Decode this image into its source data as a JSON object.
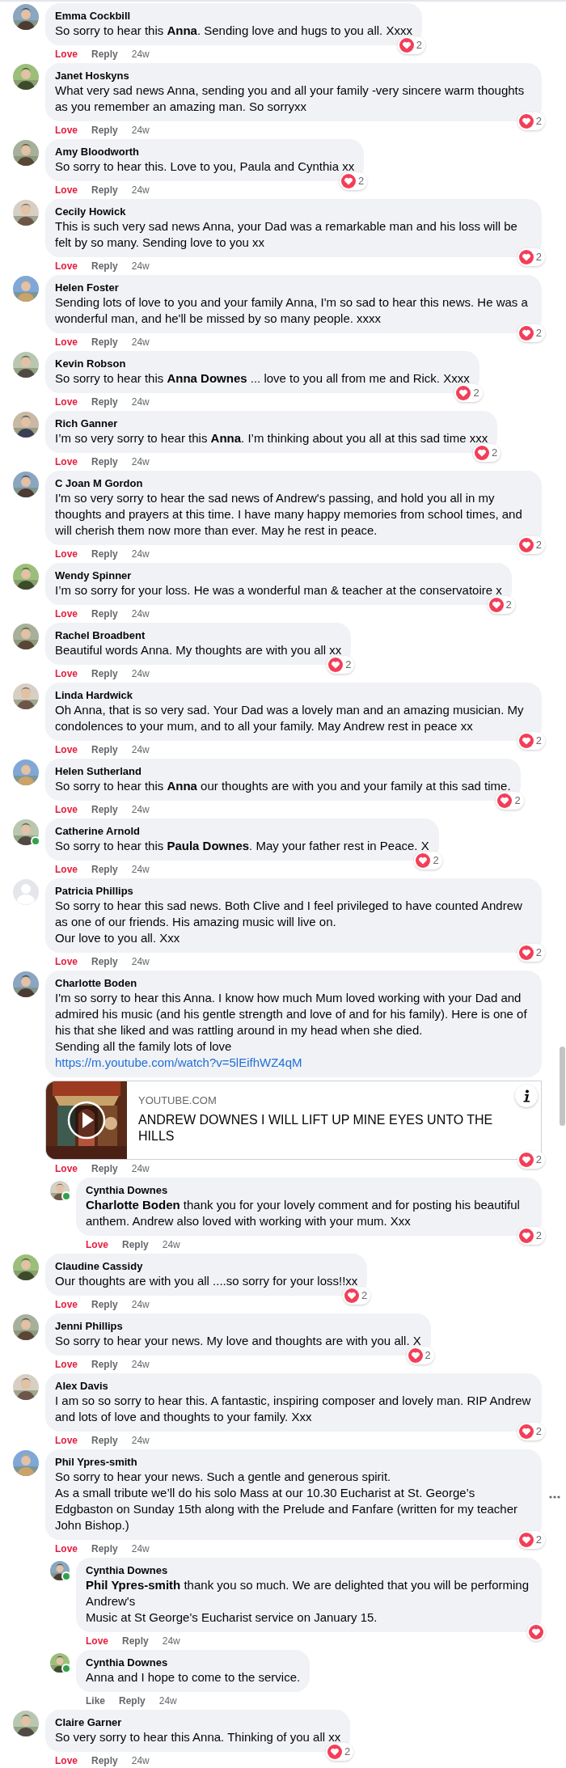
{
  "comments": [
    {
      "author": "Emma Cockbill",
      "default_avatar": false,
      "online": false,
      "text": "So sorry to hear this **Anna**. Sending love and hugs to you all. Xxxx",
      "react_label": "Love",
      "reacted": true,
      "reply_label": "Reply",
      "time": "24w",
      "reaction": {
        "kind": "love",
        "count": "2"
      }
    },
    {
      "author": "Janet Hoskyns",
      "default_avatar": false,
      "online": false,
      "text": "What very sad news Anna, sending you and all your family -very sincere warm thoughts as you remember an amazing man. So sorryxx",
      "react_label": "Love",
      "reacted": true,
      "reply_label": "Reply",
      "time": "24w",
      "reaction": {
        "kind": "love",
        "count": "2"
      }
    },
    {
      "author": "Amy Bloodworth",
      "default_avatar": false,
      "online": false,
      "text": "So sorry to hear this. Love to you, Paula and Cynthia xx",
      "react_label": "Love",
      "reacted": true,
      "reply_label": "Reply",
      "time": "24w",
      "reaction": {
        "kind": "love",
        "count": "2"
      }
    },
    {
      "author": "Cecily Howick",
      "default_avatar": false,
      "online": false,
      "text": "This is such very sad news Anna, your Dad was a remarkable man and his loss will be felt by so many. Sending love to you xx",
      "react_label": "Love",
      "reacted": true,
      "reply_label": "Reply",
      "time": "24w",
      "reaction": {
        "kind": "love",
        "count": "2"
      }
    },
    {
      "author": "Helen Foster",
      "default_avatar": false,
      "online": false,
      "text": "Sending lots of love to you and your family Anna, I'm so sad to hear this news. He was a wonderful man, and he'll be missed by so many people. xxxx",
      "react_label": "Love",
      "reacted": true,
      "reply_label": "Reply",
      "time": "24w",
      "reaction": {
        "kind": "love",
        "count": "2"
      }
    },
    {
      "author": "Kevin Robson",
      "default_avatar": false,
      "online": false,
      "text": "So sorry to hear this **Anna Downes** ... love to you all from me and Rick. Xxxx",
      "react_label": "Love",
      "reacted": true,
      "reply_label": "Reply",
      "time": "24w",
      "reaction": {
        "kind": "love",
        "count": "2"
      }
    },
    {
      "author": "Rich Ganner",
      "default_avatar": false,
      "online": false,
      "text": "I’m so very sorry to hear this **Anna**. I’m thinking about you all at this sad time xxx",
      "react_label": "Love",
      "reacted": true,
      "reply_label": "Reply",
      "time": "24w",
      "reaction": {
        "kind": "love",
        "count": "2"
      }
    },
    {
      "author": "C Joan M Gordon",
      "default_avatar": false,
      "online": false,
      "text": "I'm so very sorry to hear the sad news of Andrew's passing, and hold you all in my thoughts and prayers at this time. I have many happy memories from school times, and will cherish them now more than ever. May he rest in peace.",
      "react_label": "Love",
      "reacted": true,
      "reply_label": "Reply",
      "time": "24w",
      "reaction": {
        "kind": "love",
        "count": "2"
      }
    },
    {
      "author": "Wendy Spinner",
      "default_avatar": false,
      "online": false,
      "text": "I’m so sorry for your loss. He was a wonderful man & teacher at the conservatoire x",
      "react_label": "Love",
      "reacted": true,
      "reply_label": "Reply",
      "time": "24w",
      "reaction": {
        "kind": "love",
        "count": "2"
      }
    },
    {
      "author": "Rachel Broadbent",
      "default_avatar": false,
      "online": false,
      "text": "Beautiful words Anna. My thoughts are with you all xx",
      "react_label": "Love",
      "reacted": true,
      "reply_label": "Reply",
      "time": "24w",
      "reaction": {
        "kind": "love",
        "count": "2"
      }
    },
    {
      "author": "Linda Hardwick",
      "default_avatar": false,
      "online": false,
      "text": "Oh Anna, that is so very sad. Your Dad was a lovely man and an amazing musician. My condolences to your mum, and to all your family. May Andrew rest in peace xx",
      "react_label": "Love",
      "reacted": true,
      "reply_label": "Reply",
      "time": "24w",
      "reaction": {
        "kind": "love",
        "count": "2"
      }
    },
    {
      "author": "Helen Sutherland",
      "default_avatar": false,
      "online": false,
      "text": "So sorry to hear this **Anna** our thoughts are with you and your family at this sad time.",
      "react_label": "Love",
      "reacted": true,
      "reply_label": "Reply",
      "time": "24w",
      "reaction": {
        "kind": "love",
        "count": "2"
      }
    },
    {
      "author": "Catherine Arnold",
      "default_avatar": false,
      "online": true,
      "text": "So sorry to hear this **Paula Downes**. May your father rest in Peace. X",
      "react_label": "Love",
      "reacted": true,
      "reply_label": "Reply",
      "time": "24w",
      "reaction": {
        "kind": "love",
        "count": "2"
      }
    },
    {
      "author": "Patricia Phillips",
      "default_avatar": true,
      "online": false,
      "text": "So sorry to hear this sad news. Both Clive and I feel privileged to have counted Andrew as one of our friends. His amazing music will live on.\nOur love to you all. Xxx",
      "react_label": "Love",
      "reacted": true,
      "reply_label": "Reply",
      "time": "24w",
      "reaction": {
        "kind": "love",
        "count": "2"
      }
    },
    {
      "author": "Charlotte Boden",
      "default_avatar": false,
      "online": false,
      "text": "I'm so sorry to hear this Anna. I know how much Mum loved working with your Dad and admired his music (and his gentle strength and love of and for his family). Here is one of his that she liked and was rattling around in my head when she died.\nSending all the family lots of love",
      "link": "https://m.youtube.com/watch?v=5lEifhWZ4qM",
      "preview": {
        "domain": "YOUTUBE.COM",
        "title": "ANDREW DOWNES I WILL LIFT UP MINE EYES UNTO THE HILLS"
      },
      "react_label": "Love",
      "reacted": true,
      "reply_label": "Reply",
      "time": "24w",
      "reaction": {
        "kind": "love",
        "count": "2"
      },
      "replies": [
        {
          "author": "Cynthia Downes",
          "default_avatar": false,
          "online": true,
          "text": "**Charlotte Boden** thank you for your lovely comment and for posting his beautiful anthem. Andrew also loved with working with your mum. Xxx",
          "react_label": "Love",
          "reacted": true,
          "reply_label": "Reply",
          "time": "24w",
          "reaction": {
            "kind": "love",
            "count": "2"
          }
        }
      ]
    },
    {
      "author": "Claudine Cassidy",
      "default_avatar": false,
      "online": false,
      "text": "Our thoughts are with you all ....so sorry for your loss!!xx",
      "react_label": "Love",
      "reacted": true,
      "reply_label": "Reply",
      "time": "24w",
      "reaction": {
        "kind": "love",
        "count": "2"
      }
    },
    {
      "author": "Jenni Phillips",
      "default_avatar": false,
      "online": false,
      "text": "So sorry to hear your news. My love and thoughts are with you all. X",
      "react_label": "Love",
      "reacted": true,
      "reply_label": "Reply",
      "time": "24w",
      "reaction": {
        "kind": "love",
        "count": "2"
      }
    },
    {
      "author": "Alex Davis",
      "default_avatar": false,
      "online": false,
      "text": "I am so so sorry to hear this. A fantastic, inspiring composer and lovely man. RIP Andrew and lots of love and thoughts to your family. Xxx",
      "react_label": "Love",
      "reacted": true,
      "reply_label": "Reply",
      "time": "24w",
      "reaction": {
        "kind": "love",
        "count": "2"
      }
    },
    {
      "author": "Phil Ypres-smith",
      "default_avatar": false,
      "online": false,
      "more_options": true,
      "text": "So sorry to hear your news. Such a gentle and generous spirit.\nAs a small tribute we’ll do his solo Mass at our 10.30 Eucharist at St. George’s Edgbaston on Sunday 15th along with the Prelude and Fanfare (written for my teacher John Bishop.)",
      "react_label": "Love",
      "reacted": true,
      "reply_label": "Reply",
      "time": "24w",
      "reaction": {
        "kind": "love",
        "count": "2"
      },
      "replies": [
        {
          "author": "Cynthia Downes",
          "default_avatar": false,
          "online": true,
          "text": "**Phil Ypres-smith** thank you so much. We are delighted that you will be performing Andrew's\nMusic at St George's Eucharist service on January 15.",
          "react_label": "Love",
          "reacted": true,
          "reply_label": "Reply",
          "time": "24w",
          "reaction": {
            "kind": "love"
          }
        },
        {
          "author": "Cynthia Downes",
          "default_avatar": false,
          "online": true,
          "text": "Anna and I hope to come to the service.",
          "react_label": "Like",
          "reacted": false,
          "reply_label": "Reply",
          "time": "24w"
        }
      ]
    },
    {
      "author": "Claire Garner",
      "default_avatar": false,
      "online": false,
      "text": "So very sorry to hear this Anna. Thinking of you all xx",
      "react_label": "Love",
      "reacted": true,
      "reply_label": "Reply",
      "time": "24w",
      "reaction": {
        "kind": "love",
        "count": "2"
      }
    }
  ]
}
